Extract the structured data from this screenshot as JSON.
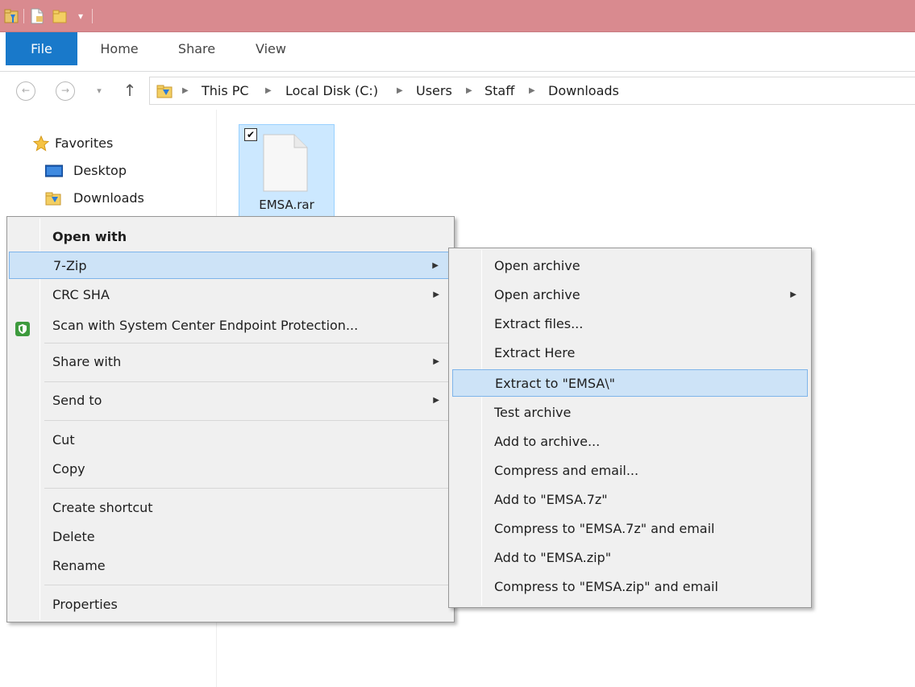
{
  "ribbon": {
    "tabs": [
      "File",
      "Home",
      "Share",
      "View"
    ],
    "active_tab": "File"
  },
  "icons": {
    "qat": [
      "folder-properties-icon",
      "new-item-icon",
      "new-folder-icon",
      "customize-qat-icon"
    ],
    "nav": [
      "back-icon",
      "forward-icon",
      "recent-locations-icon",
      "up-icon"
    ]
  },
  "address": {
    "breadcrumbs": [
      "This PC",
      "Local Disk (C:)",
      "Users",
      "Staff",
      "Downloads"
    ]
  },
  "nav_pane": {
    "items": [
      {
        "label": "Favorites",
        "icon": "star-icon"
      },
      {
        "label": "Desktop",
        "icon": "desktop-icon"
      },
      {
        "label": "Downloads",
        "icon": "downloads-folder-icon"
      }
    ]
  },
  "file": {
    "name": "EMSA.rar",
    "checked": true,
    "check_glyph": "✔"
  },
  "context_menu": {
    "items": [
      {
        "label": "Open with",
        "bold": true
      },
      {
        "label": "7-Zip",
        "submenu": true,
        "highlighted": true
      },
      {
        "label": "CRC SHA",
        "submenu": true
      },
      {
        "label": "Scan with System Center Endpoint Protection...",
        "icon": "endpoint-protection-icon"
      },
      {
        "label": "Share with",
        "submenu": true
      },
      {
        "label": "Send to",
        "submenu": true
      },
      {
        "label": "Cut"
      },
      {
        "label": "Copy"
      },
      {
        "label": "Create shortcut"
      },
      {
        "label": "Delete"
      },
      {
        "label": "Rename"
      },
      {
        "label": "Properties"
      }
    ]
  },
  "submenu_7zip": {
    "items": [
      {
        "label": "Open archive"
      },
      {
        "label": "Open archive",
        "submenu": true
      },
      {
        "label": "Extract files..."
      },
      {
        "label": "Extract Here"
      },
      {
        "label": "Extract to \"EMSA\\\"",
        "highlighted": true
      },
      {
        "label": "Test archive"
      },
      {
        "label": "Add to archive..."
      },
      {
        "label": "Compress and email..."
      },
      {
        "label": "Add to \"EMSA.7z\""
      },
      {
        "label": "Compress to \"EMSA.7z\" and email"
      },
      {
        "label": "Add to \"EMSA.zip\""
      },
      {
        "label": "Compress to \"EMSA.zip\" and email"
      }
    ]
  },
  "glyphs": {
    "submenu_arrow": "▶",
    "breadcrumb_sep": "▶",
    "back": "←",
    "forward": "→",
    "up": "↑",
    "dropdown": "▾"
  },
  "colors": {
    "titlebar": "#d98a8f",
    "file_tab": "#1979ca",
    "menu_bg": "#f0f0f0",
    "highlight": "#cde3f7",
    "highlight_border": "#7eb4ea",
    "selection": "#cce8ff"
  }
}
